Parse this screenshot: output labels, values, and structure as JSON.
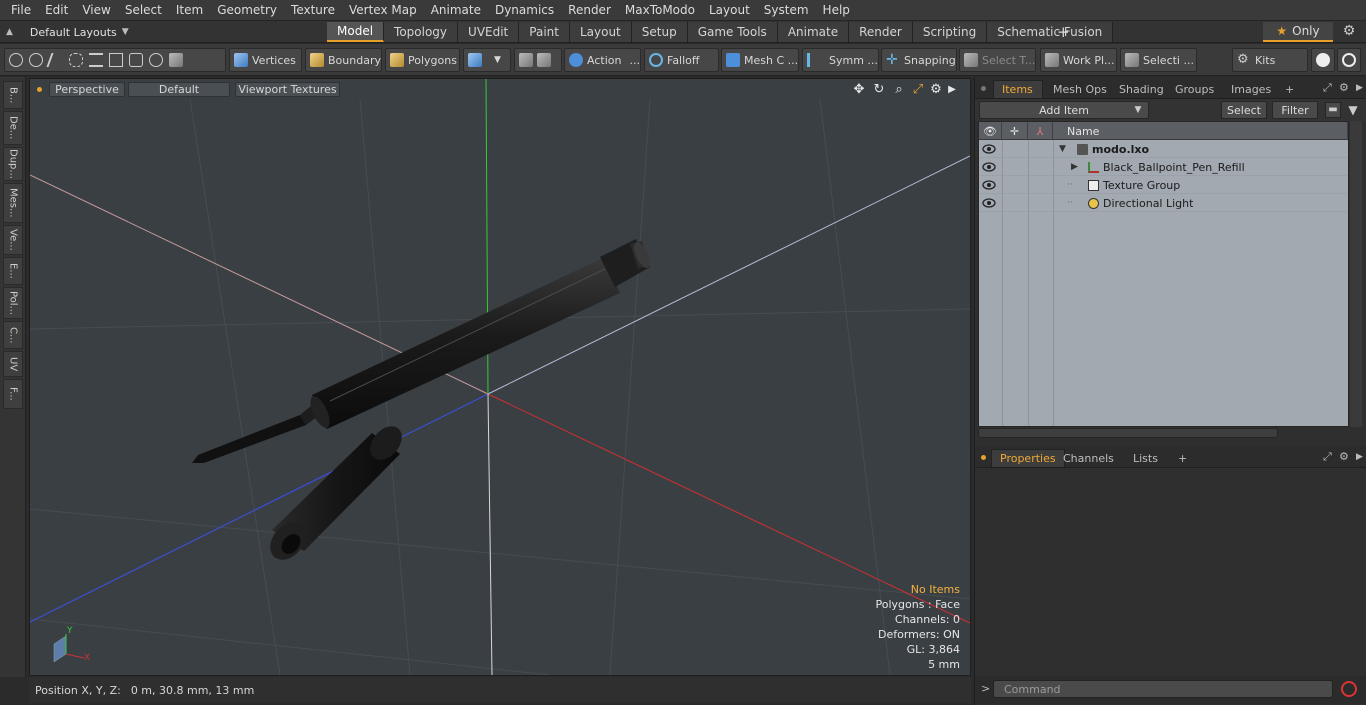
{
  "menu": [
    "File",
    "Edit",
    "View",
    "Select",
    "Item",
    "Geometry",
    "Texture",
    "Vertex Map",
    "Animate",
    "Dynamics",
    "Render",
    "MaxToModo",
    "Layout",
    "System",
    "Help"
  ],
  "layout": {
    "selector": "Default Layouts",
    "tabs": [
      "Model",
      "Topology",
      "UVEdit",
      "Paint",
      "Layout",
      "Setup",
      "Game Tools",
      "Animate",
      "Render",
      "Scripting",
      "Schematic Fusion"
    ],
    "active_tab": "Model",
    "add": "+",
    "only_label": "Only"
  },
  "toolbar": {
    "vertices": "Vertices",
    "boundary": "Boundary",
    "polygons": "Polygons",
    "action": "Action",
    "falloff": "Falloff",
    "mesh": "Mesh C ...",
    "symm": "Symm ...",
    "snapping": "Snapping",
    "select_t": "Select T...",
    "work_pl": "Work Pl...",
    "selecti": "Selecti ...",
    "kits": "Kits",
    "action_more": "..."
  },
  "left_tabs": [
    "B...",
    "De...",
    "Dup...",
    "Mes...",
    "Ve...",
    "E...",
    "Pol...",
    "C...",
    "UV",
    "F..."
  ],
  "viewport": {
    "view": "Perspective",
    "shading": "Default",
    "textures": "Viewport Textures",
    "info": {
      "no_items": "No Items",
      "polygons": "Polygons : Face",
      "channels": "Channels: 0",
      "deformers": "Deformers: ON",
      "gl": "GL: 3,864",
      "scale": "5 mm"
    },
    "gizmo": {
      "y": "Y",
      "x": "X"
    }
  },
  "status": {
    "label": "Position X, Y, Z:",
    "value": "0 m, 30.8 mm, 13 mm"
  },
  "items_panel": {
    "tabs": [
      "Items",
      "Mesh Ops",
      "Shading",
      "Groups",
      "Images"
    ],
    "active_tab": "Items",
    "add": "+",
    "add_item": "Add Item",
    "select": "Select",
    "filter": "Filter",
    "column_name": "Name",
    "rows": [
      {
        "label": "modo.lxo"
      },
      {
        "label": "Black_Ballpoint_Pen_Refill"
      },
      {
        "label": "Texture Group"
      },
      {
        "label": "Directional Light"
      }
    ]
  },
  "properties_panel": {
    "tabs": [
      "Properties",
      "Channels",
      "Lists"
    ],
    "active_tab": "Properties",
    "add": "+"
  },
  "command": {
    "prompt": ">",
    "placeholder": "Command"
  },
  "colors": {
    "accent": "#e6a12a",
    "axis_x": "#d03030",
    "axis_y": "#33cc33",
    "axis_z": "#3a4fd8",
    "tree_bg": "#a2a9b1"
  }
}
